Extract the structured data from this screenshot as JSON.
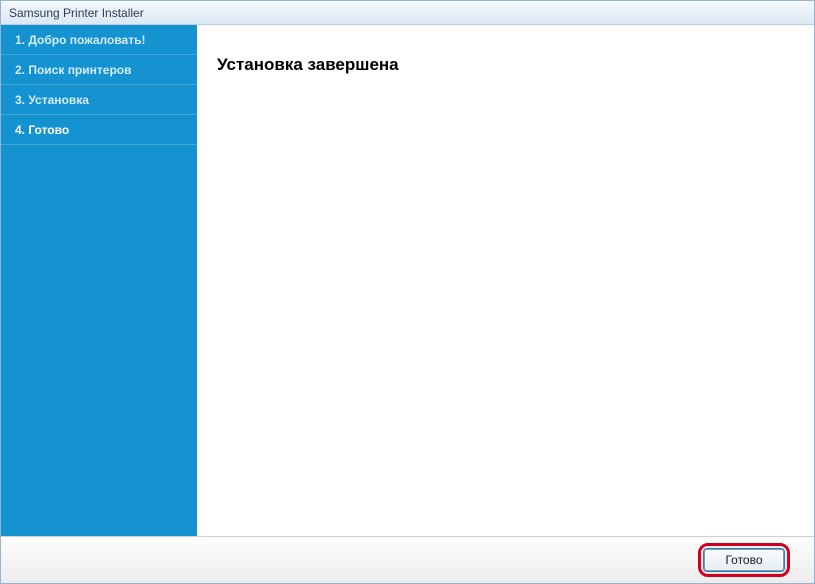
{
  "window": {
    "title": "Samsung Printer Installer"
  },
  "sidebar": {
    "items": [
      {
        "label": "1. Добро пожаловать!",
        "active": false
      },
      {
        "label": "2. Поиск принтеров",
        "active": false
      },
      {
        "label": "3. Установка",
        "active": false
      },
      {
        "label": "4. Готово",
        "active": true
      }
    ]
  },
  "main": {
    "heading": "Установка завершена"
  },
  "footer": {
    "finish_label": "Готово"
  },
  "colors": {
    "sidebar_bg": "#1592d0",
    "highlight": "#d4001f"
  }
}
